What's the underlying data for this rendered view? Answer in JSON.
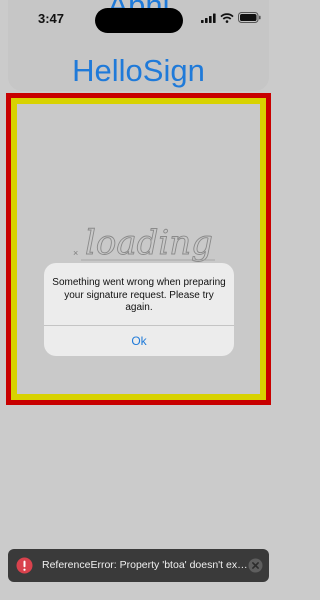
{
  "status_bar": {
    "time": "3:47",
    "icons": [
      "signal-icon",
      "wifi-icon",
      "battery-icon"
    ]
  },
  "header": {
    "app_name": "Abhi",
    "title": "HelloSign"
  },
  "signature_preview": {
    "watermark_text": "loading"
  },
  "alert": {
    "message": "Something went wrong when preparing your signature request. Please try again.",
    "button_label": "Ok"
  },
  "error_toast": {
    "message": "ReferenceError: Property 'btoa' doesn't ex…",
    "icon": "error-icon",
    "close_icon": "close-icon"
  },
  "colors": {
    "accent": "#1f7ad9",
    "frame_outer": "#c80000",
    "frame_inner": "#d8d200",
    "toast_bg": "#3a3a3a",
    "error_icon": "#d9424d"
  }
}
